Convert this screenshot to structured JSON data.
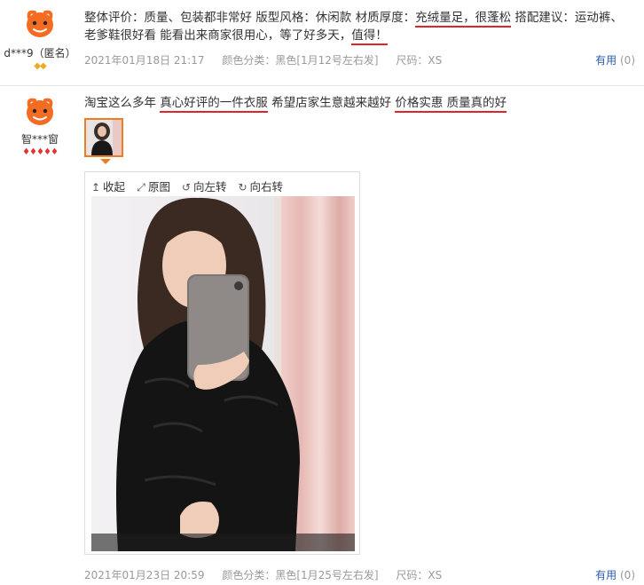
{
  "reviews": [
    {
      "username": "d***9（匿名）",
      "text_parts": [
        {
          "t": "整体评价：质量、包装都非常好 版型风格：休闲款 材质厚度：",
          "u": false
        },
        {
          "t": "充绒量足，很蓬松",
          "u": true
        },
        {
          "t": " 搭配建议：运动裤、老爹鞋很好看 能看出来商家很用心，等了好多天，",
          "u": false
        },
        {
          "t": "值得！",
          "u": true
        }
      ],
      "date": "2021年01月18日 21:17",
      "color_class": "颜色分类：黑色[1月12号左右发]",
      "size": "尺码：XS",
      "helpful_label": "有用",
      "helpful_count": "(0)",
      "badges": "◆◆"
    },
    {
      "username": "智***窗",
      "text_parts": [
        {
          "t": "淘宝这么多年 ",
          "u": false
        },
        {
          "t": "真心好评的一件衣服",
          "u": true
        },
        {
          "t": " 希望店家生意越来越好 ",
          "u": false
        },
        {
          "t": "价格实惠 质量真的好",
          "u": true
        }
      ],
      "date": "2021年01月23日 20:59",
      "color_class": "颜色分类：黑色[1月25号左右发]",
      "size": "尺码：XS",
      "helpful_label": "有用",
      "helpful_count": "(0)",
      "badges": "♦♦♦♦♦"
    }
  ],
  "viewer": {
    "collapse": "收起",
    "original": "原图",
    "rotate_left": "向左转",
    "rotate_right": "向右转"
  },
  "colors": {
    "underline": "#e0242a",
    "helpful_link": "#2a5db0",
    "thumb_border": "#f07b20"
  }
}
